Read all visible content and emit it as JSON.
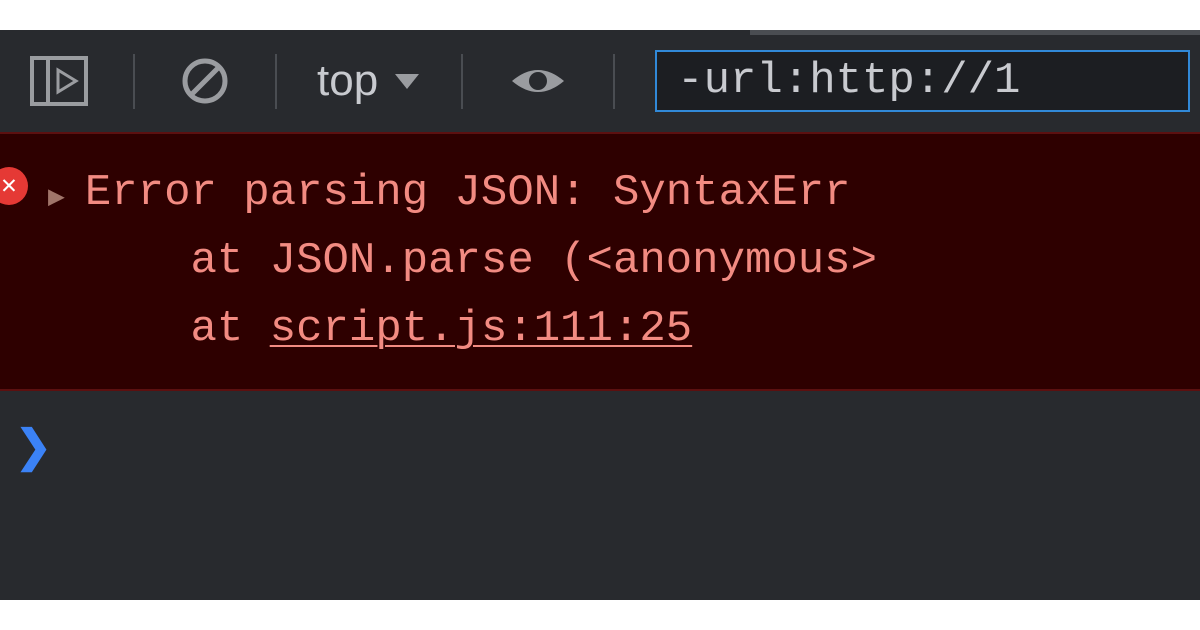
{
  "toolbar": {
    "context_label": "top",
    "filter_value": "-url:http://1"
  },
  "console": {
    "error": {
      "line1": "Error parsing JSON: SyntaxErr",
      "line2_prefix": "    at JSON.parse (<anonymous>",
      "line3_prefix": "    at ",
      "line3_link": "script.js:111:25"
    }
  }
}
